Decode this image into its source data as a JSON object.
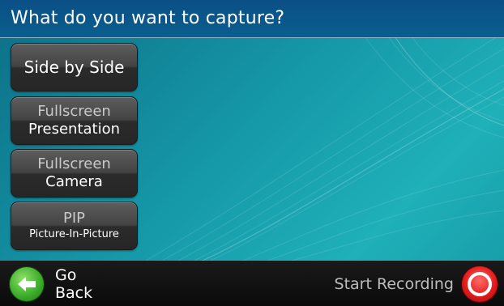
{
  "header": {
    "title": "What do you want to capture?"
  },
  "options": [
    {
      "line1": "Side by Side",
      "line2": ""
    },
    {
      "line1": "Fullscreen",
      "line2": "Presentation"
    },
    {
      "line1": "Fullscreen",
      "line2": "Camera"
    },
    {
      "line1": "PIP",
      "line2": "Picture-In-Picture"
    }
  ],
  "footer": {
    "back_label": "Go Back",
    "record_label": "Start Recording"
  },
  "colors": {
    "title_bar": "#0a5e8e",
    "background": "#1597a8",
    "back_icon": "#3fae2c",
    "record_icon": "#e31b1b"
  },
  "icons": {
    "back": "arrow-left-icon",
    "record": "record-icon"
  }
}
